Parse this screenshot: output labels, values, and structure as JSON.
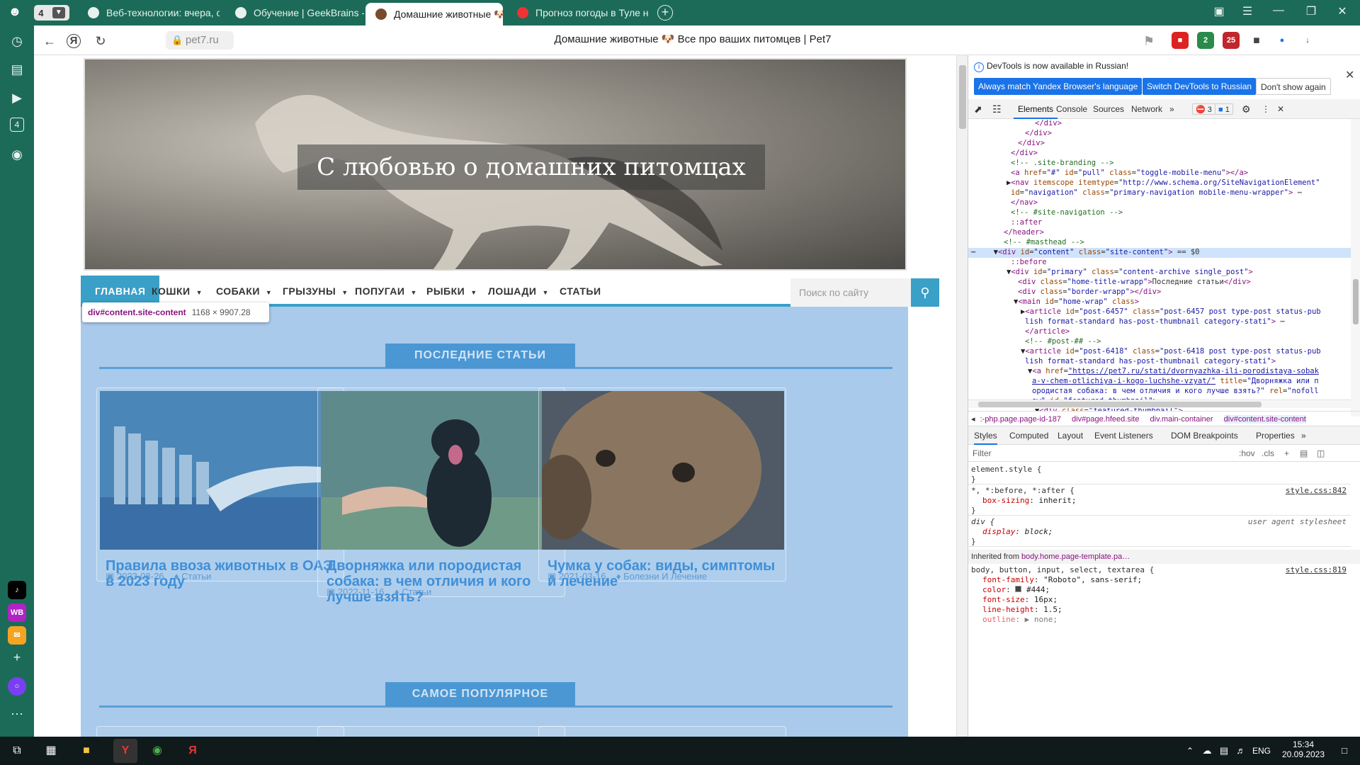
{
  "browser": {
    "tab_count": "4",
    "tabs": [
      {
        "label": "Веб-технологии: вчера, се",
        "active": false
      },
      {
        "label": "Обучение | GeekBrains - о",
        "active": false
      },
      {
        "label": "Домашние животные 🐶",
        "active": true
      },
      {
        "label": "Прогноз погоды в Туле на",
        "active": false
      }
    ],
    "url": "pet7.ru",
    "page_title": "Домашние животные 🐶 Все про ваших питомцев | Pet7",
    "ext_badges": {
      "ext2": "2",
      "ext3": "25"
    }
  },
  "sidebar": {
    "badge_count": "4"
  },
  "site": {
    "hero_title": "С любовью о домашних питомцах",
    "menu": [
      {
        "label": "ГЛАВНАЯ",
        "has_dropdown": false,
        "active": true
      },
      {
        "label": "КОШКИ",
        "has_dropdown": true
      },
      {
        "label": "СОБАКИ",
        "has_dropdown": true
      },
      {
        "label": "ГРЫЗУНЫ",
        "has_dropdown": true
      },
      {
        "label": "ПОПУГАИ",
        "has_dropdown": true
      },
      {
        "label": "РЫБКИ",
        "has_dropdown": true
      },
      {
        "label": "ЛОШАДИ",
        "has_dropdown": true
      },
      {
        "label": "СТАТЬИ",
        "has_dropdown": false
      }
    ],
    "search_placeholder": "Поиск по сайту",
    "inspect_tooltip": {
      "selector": "div#content.site-content",
      "size": "1168 × 9907.28"
    },
    "latest_heading": "ПОСЛЕДНИЕ СТАТЬИ",
    "popular_heading": "САМОЕ ПОПУЛЯРНОЕ",
    "articles": [
      {
        "title": "Правила ввоза животных в ОАЭ в 2023 году",
        "date": "2023-08-26",
        "category": "Статьи"
      },
      {
        "title": "Дворняжка или породистая собака: в чем отличия и кого лучше взять?",
        "date": "2022-11-16",
        "category": "Статьи"
      },
      {
        "title": "Чумка у собак: виды, симптомы и лечение",
        "date": "2021-03-16",
        "category": "Болезни И Лечение"
      }
    ]
  },
  "devtools": {
    "info": "DevTools is now available in Russian!",
    "btn_match": "Always match Yandex Browser's language",
    "btn_switch": "Switch DevTools to Russian",
    "btn_dont": "Don't show again",
    "tabs": [
      "Elements",
      "Console",
      "Sources",
      "Network"
    ],
    "errors": "3",
    "messages": "1",
    "breadcrumbs": [
      ":-php.page.page-id-187",
      "div#page.hfeed.site",
      "div.main-container",
      "div#content.site-content"
    ],
    "style_tabs": [
      "Styles",
      "Computed",
      "Layout",
      "Event Listeners",
      "DOM Breakpoints",
      "Properties"
    ],
    "filter_placeholder": "Filter",
    "filter_hov": ":hov",
    "filter_cls": ".cls",
    "rules": {
      "element_style": "element.style {",
      "universal_selector": "*, *:before, *:after {",
      "universal_prop": "box-sizing",
      "universal_val": "inherit;",
      "universal_src": "style.css:842",
      "div_selector": "div {",
      "div_prop": "display",
      "div_val": "block;",
      "div_src": "user agent stylesheet",
      "inherited": "Inherited from",
      "inherited_el": "body.home.page-template.pa…",
      "body_selector": "body, button, input, select, textarea {",
      "body_src": "style.css:819",
      "body_props": [
        {
          "p": "font-family",
          "v": "\"Roboto\", sans-serif;"
        },
        {
          "p": "color",
          "v": "#444;"
        },
        {
          "p": "font-size",
          "v": "16px;"
        },
        {
          "p": "line-height",
          "v": "1.5;"
        },
        {
          "p": "outline",
          "v": "▶ none;"
        }
      ]
    }
  },
  "taskbar": {
    "lang": "ENG",
    "time": "15:34",
    "date": "20.09.2023"
  }
}
